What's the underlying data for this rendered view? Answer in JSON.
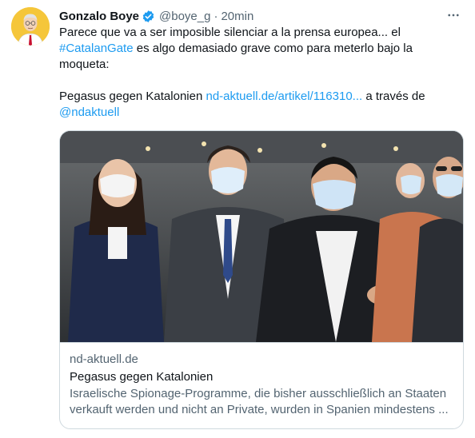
{
  "tweet": {
    "author_name": "Gonzalo Boye",
    "handle": "@boye_g",
    "separator": "·",
    "time": "20min",
    "text_line1": "Parece que va a ser imposible silenciar a la prensa europea... el",
    "hashtag": "#CatalanGate",
    "text_line2_rest": " es algo demasiado grave como para meterlo bajo la",
    "text_line3": "moqueta:",
    "text_line4_start": "Pegasus gegen Katalonien ",
    "url": "nd-aktuell.de/artikel/116310...",
    "text_line4_end": " a través de",
    "mention": "@ndaktuell"
  },
  "card": {
    "domain": "nd-aktuell.de",
    "title": "Pegasus gegen Katalonien",
    "description_line1": "Israelische Spionage-Programme, die bisher ausschließlich an Staaten",
    "description_line2": "verkauft werden und nicht an Private, wurden in Spanien mindestens ..."
  },
  "icons": {
    "verified": "verified-badge-icon",
    "more": "more-options-icon"
  },
  "colors": {
    "link": "#1d9bf0",
    "secondary_text": "#536471",
    "primary_text": "#0f1419",
    "avatar_bg": "#f5c63a"
  }
}
